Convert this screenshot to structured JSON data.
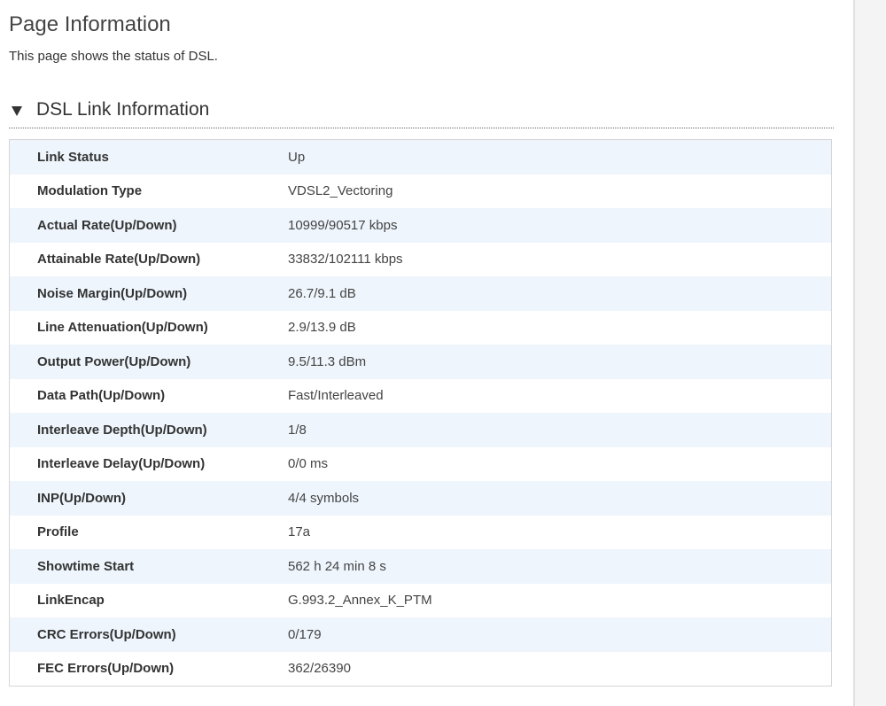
{
  "page": {
    "title": "Page Information",
    "description": "This page shows the status of DSL."
  },
  "section": {
    "title": "DSL Link Information",
    "expanded_icon": "triangle-down-icon"
  },
  "rows": [
    {
      "label": "Link Status",
      "value": "Up"
    },
    {
      "label": "Modulation Type",
      "value": "VDSL2_Vectoring"
    },
    {
      "label": "Actual Rate(Up/Down)",
      "value": "10999/90517 kbps"
    },
    {
      "label": "Attainable Rate(Up/Down)",
      "value": "33832/102111 kbps"
    },
    {
      "label": "Noise Margin(Up/Down)",
      "value": "26.7/9.1 dB"
    },
    {
      "label": "Line Attenuation(Up/Down)",
      "value": "2.9/13.9 dB"
    },
    {
      "label": "Output Power(Up/Down)",
      "value": "9.5/11.3 dBm"
    },
    {
      "label": "Data Path(Up/Down)",
      "value": "Fast/Interleaved"
    },
    {
      "label": "Interleave Depth(Up/Down)",
      "value": "1/8"
    },
    {
      "label": "Interleave Delay(Up/Down)",
      "value": "0/0 ms"
    },
    {
      "label": "INP(Up/Down)",
      "value": "4/4 symbols"
    },
    {
      "label": "Profile",
      "value": "17a"
    },
    {
      "label": "Showtime Start",
      "value": "562 h 24 min 8 s"
    },
    {
      "label": "LinkEncap",
      "value": "G.993.2_Annex_K_PTM"
    },
    {
      "label": "CRC Errors(Up/Down)",
      "value": "0/179"
    },
    {
      "label": "FEC Errors(Up/Down)",
      "value": "362/26390"
    }
  ],
  "colors": {
    "stripe": "#eef5fc",
    "border": "#d6d6d6"
  }
}
